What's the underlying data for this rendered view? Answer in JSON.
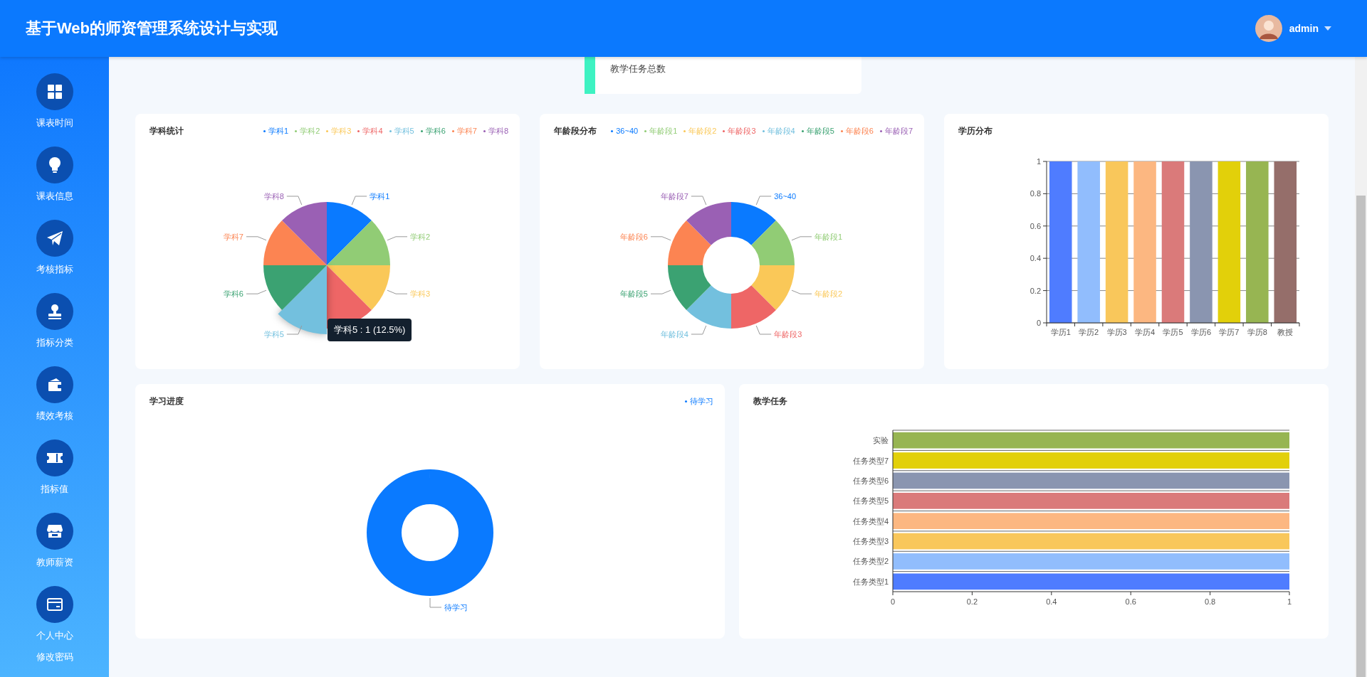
{
  "header": {
    "title": "基于Web的师资管理系统设计与实现",
    "user": "admin"
  },
  "sidebar": {
    "items": [
      {
        "kind": "icon",
        "label": "课表时间"
      },
      {
        "kind": "icon",
        "label": "课表信息"
      },
      {
        "kind": "icon",
        "label": "考核指标"
      },
      {
        "kind": "icon",
        "label": "指标分类"
      },
      {
        "kind": "icon",
        "label": "绩效考核"
      },
      {
        "kind": "icon",
        "label": "指标值"
      },
      {
        "kind": "icon",
        "label": "教师薪资"
      },
      {
        "kind": "icon",
        "label": "个人中心"
      },
      {
        "kind": "text",
        "label": "修改密码"
      }
    ]
  },
  "summary_card": {
    "label": "教学任务总数"
  },
  "charts": [
    {
      "legend": [
        {
          "color": "#0a7aff"
        },
        {
          "color": "#91cc75"
        },
        {
          "color": "#fac858"
        },
        {
          "color": "#ee6666"
        },
        {
          "color": "#73c0de"
        },
        {
          "color": "#3ba272"
        },
        {
          "color": "#fc8452"
        },
        {
          "color": "#9a60b4"
        }
      ],
      "slices": [
        {
          "hovered": false,
          "label": "学科1"
        },
        {
          "hovered": false,
          "label": "学科2"
        },
        {
          "hovered": false,
          "label": "学科3"
        },
        {
          "hovered": false
        },
        {
          "hovered": true,
          "label": "学科5"
        },
        {
          "hovered": false,
          "label": "学科6"
        },
        {
          "hovered": false,
          "label": "学科7"
        },
        {
          "hovered": false,
          "label": "学科8"
        }
      ],
      "tooltip": {
        "text": "学科5 : 1 (12.5%)"
      },
      "chart_data": {
        "type": "pie",
        "title": "学科统计",
        "categories": [
          "学科1",
          "学科2",
          "学科3",
          "学科4",
          "学科5",
          "学科6",
          "学科7",
          "学科8"
        ],
        "values": [
          1,
          1,
          1,
          1,
          1,
          1,
          1,
          1
        ]
      }
    },
    {
      "legend": [
        {
          "color": "#0a7aff"
        },
        {
          "color": "#91cc75"
        },
        {
          "color": "#fac858"
        },
        {
          "color": "#ee6666"
        },
        {
          "color": "#73c0de"
        },
        {
          "color": "#3ba272"
        },
        {
          "color": "#fc8452"
        },
        {
          "color": "#9a60b4"
        }
      ],
      "slices": [
        {
          "hovered": false,
          "label": "36~40"
        },
        {
          "hovered": false,
          "label": "年龄段1"
        },
        {
          "hovered": false,
          "label": "年龄段2"
        },
        {
          "hovered": false,
          "label": "年龄段3"
        },
        {
          "hovered": false,
          "label": "年龄段4"
        },
        {
          "hovered": false,
          "label": "年龄段5"
        },
        {
          "hovered": false,
          "label": "年龄段6"
        },
        {
          "hovered": false,
          "label": "年龄段7"
        }
      ],
      "chart_data": {
        "type": "donut",
        "title": "年龄段分布",
        "categories": [
          "36~40",
          "年龄段1",
          "年龄段2",
          "年龄段3",
          "年龄段4",
          "年龄段5",
          "年龄段6",
          "年龄段7"
        ],
        "values": [
          1,
          1,
          1,
          1,
          1,
          1,
          1,
          1
        ]
      }
    },
    {
      "bars": [
        {
          "color": "#4f7cff"
        },
        {
          "color": "#91bdfd"
        },
        {
          "color": "#f9c75b"
        },
        {
          "color": "#fcb781"
        },
        {
          "color": "#da7a7a"
        },
        {
          "color": "#8a95b0"
        },
        {
          "color": "#e2d00a"
        },
        {
          "color": "#97b552"
        },
        {
          "color": "#956e6a"
        }
      ],
      "chart_data": {
        "type": "bar",
        "title": "学历分布",
        "categories": [
          "学历1",
          "学历2",
          "学历3",
          "学历4",
          "学历5",
          "学历6",
          "学历7",
          "学历8",
          "教授"
        ],
        "values": [
          1,
          1,
          1,
          1,
          1,
          1,
          1,
          1,
          1
        ],
        "ylim": [
          0,
          1
        ],
        "yticks": [
          0,
          0.2,
          0.4,
          0.6,
          0.8,
          1
        ],
        "grid": true
      }
    },
    {
      "legend": [
        {
          "color": "#0a7aff"
        }
      ],
      "slices": [
        {
          "hovered": false,
          "label": "待学习"
        }
      ],
      "ring": true,
      "chart_data": {
        "type": "pie",
        "title": "学习进度",
        "categories": [
          "待学习"
        ],
        "values": [
          1
        ]
      }
    },
    {
      "bars": [
        {
          "color": "#97b552"
        },
        {
          "color": "#e2d00a"
        },
        {
          "color": "#8a95b0"
        },
        {
          "color": "#da7a7a"
        },
        {
          "color": "#fcb781"
        },
        {
          "color": "#f9c75b"
        },
        {
          "color": "#91bdfd"
        },
        {
          "color": "#4f7cff"
        }
      ],
      "chart_data": {
        "type": "bar",
        "orientation": "horizontal",
        "title": "教学任务",
        "categories": [
          "实验",
          "任务类型7",
          "任务类型6",
          "任务类型5",
          "任务类型4",
          "任务类型3",
          "任务类型2",
          "任务类型1"
        ],
        "values": [
          1,
          1,
          1,
          1,
          1,
          1,
          1,
          1
        ],
        "xlim": [
          0,
          1
        ],
        "xticks": [
          0,
          0.2,
          0.4,
          0.6,
          0.8,
          1
        ],
        "grid": true
      }
    }
  ]
}
